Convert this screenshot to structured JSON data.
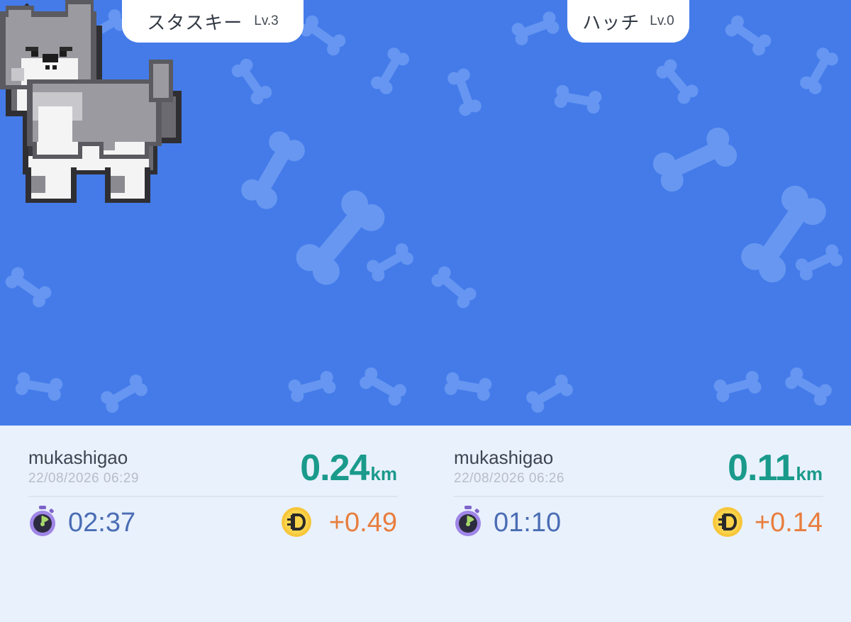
{
  "colors": {
    "stage_bg": "#447be9",
    "bone": "#6d9bf2",
    "info_bg": "#e9f1fd",
    "distance": "#1a9a8b",
    "time": "#4a6db4",
    "earn": "#e87d3d"
  },
  "walks": [
    {
      "pet": {
        "name": "スタスキー",
        "level": "Lv.3",
        "breed_icon": "husky-dog-icon"
      },
      "user": "mukashigao",
      "datetime": "22/08/2026 06:29",
      "distance": {
        "value": "0.24",
        "unit": "km"
      },
      "duration": "02:37",
      "earnings": "+0.49",
      "icons": {
        "timer": "stopwatch-icon",
        "coin": "coin-icon"
      }
    },
    {
      "pet": {
        "name": "ハッチ",
        "level": "Lv.0",
        "breed_icon": "schnauzer-dog-icon"
      },
      "user": "mukashigao",
      "datetime": "22/08/2026 06:26",
      "distance": {
        "value": "0.11",
        "unit": "km"
      },
      "duration": "01:10",
      "earnings": "+0.14",
      "icons": {
        "timer": "stopwatch-icon",
        "coin": "coin-icon"
      }
    }
  ]
}
